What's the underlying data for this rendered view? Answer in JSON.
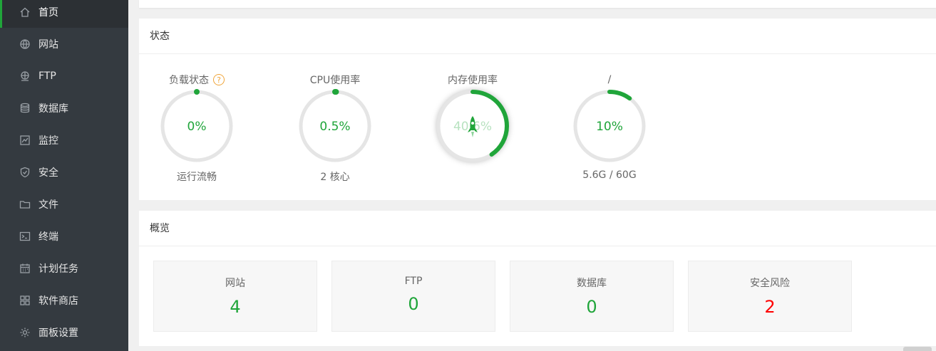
{
  "sidebar": {
    "items": [
      {
        "label": "首页",
        "icon": "home-icon",
        "active": true
      },
      {
        "label": "网站",
        "icon": "globe-icon"
      },
      {
        "label": "FTP",
        "icon": "ftp-icon"
      },
      {
        "label": "数据库",
        "icon": "database-icon"
      },
      {
        "label": "监控",
        "icon": "monitor-icon"
      },
      {
        "label": "安全",
        "icon": "shield-icon"
      },
      {
        "label": "文件",
        "icon": "folder-icon"
      },
      {
        "label": "终端",
        "icon": "terminal-icon"
      },
      {
        "label": "计划任务",
        "icon": "calendar-icon"
      },
      {
        "label": "软件商店",
        "icon": "apps-icon"
      },
      {
        "label": "面板设置",
        "icon": "gear-icon"
      }
    ]
  },
  "status": {
    "title": "状态",
    "gauges": [
      {
        "label": "负载状态",
        "value": "0%",
        "percent": 0,
        "sub": "运行流畅",
        "help": "?"
      },
      {
        "label": "CPU使用率",
        "value": "0.5%",
        "percent": 0.5,
        "sub": "2 核心"
      },
      {
        "label": "内存使用率",
        "value": "40.6%",
        "percent": 40.6,
        "sub": ""
      },
      {
        "label": "/",
        "value": "10%",
        "percent": 10,
        "sub": "5.6G / 60G"
      }
    ]
  },
  "overview": {
    "title": "概览",
    "cards": [
      {
        "label": "网站",
        "value": "4"
      },
      {
        "label": "FTP",
        "value": "0"
      },
      {
        "label": "数据库",
        "value": "0"
      },
      {
        "label": "安全风险",
        "value": "2"
      }
    ]
  },
  "colors": {
    "accent": "#20a53a",
    "danger": "#ff0000",
    "sidebar_bg": "#343a40",
    "ring_track": "#e5e5e5",
    "help": "#f0a53a"
  }
}
